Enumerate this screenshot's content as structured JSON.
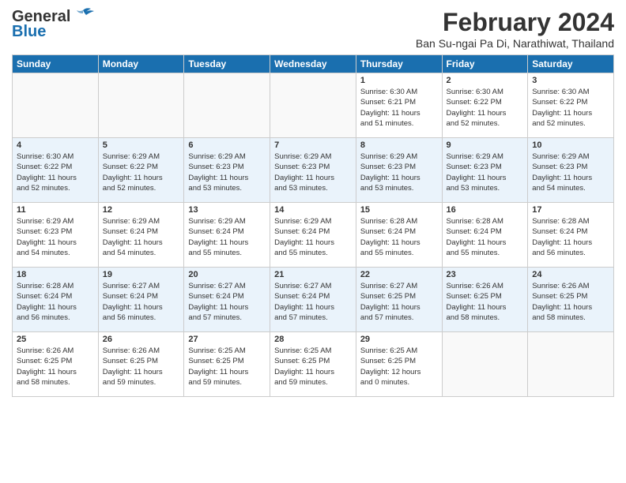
{
  "header": {
    "logo_line1": "General",
    "logo_line2": "Blue",
    "month": "February 2024",
    "location": "Ban Su-ngai Pa Di, Narathiwat, Thailand"
  },
  "columns": [
    "Sunday",
    "Monday",
    "Tuesday",
    "Wednesday",
    "Thursday",
    "Friday",
    "Saturday"
  ],
  "weeks": [
    [
      {
        "day": "",
        "info": ""
      },
      {
        "day": "",
        "info": ""
      },
      {
        "day": "",
        "info": ""
      },
      {
        "day": "",
        "info": ""
      },
      {
        "day": "1",
        "info": "Sunrise: 6:30 AM\nSunset: 6:21 PM\nDaylight: 11 hours\nand 51 minutes."
      },
      {
        "day": "2",
        "info": "Sunrise: 6:30 AM\nSunset: 6:22 PM\nDaylight: 11 hours\nand 52 minutes."
      },
      {
        "day": "3",
        "info": "Sunrise: 6:30 AM\nSunset: 6:22 PM\nDaylight: 11 hours\nand 52 minutes."
      }
    ],
    [
      {
        "day": "4",
        "info": "Sunrise: 6:30 AM\nSunset: 6:22 PM\nDaylight: 11 hours\nand 52 minutes."
      },
      {
        "day": "5",
        "info": "Sunrise: 6:29 AM\nSunset: 6:22 PM\nDaylight: 11 hours\nand 52 minutes."
      },
      {
        "day": "6",
        "info": "Sunrise: 6:29 AM\nSunset: 6:23 PM\nDaylight: 11 hours\nand 53 minutes."
      },
      {
        "day": "7",
        "info": "Sunrise: 6:29 AM\nSunset: 6:23 PM\nDaylight: 11 hours\nand 53 minutes."
      },
      {
        "day": "8",
        "info": "Sunrise: 6:29 AM\nSunset: 6:23 PM\nDaylight: 11 hours\nand 53 minutes."
      },
      {
        "day": "9",
        "info": "Sunrise: 6:29 AM\nSunset: 6:23 PM\nDaylight: 11 hours\nand 53 minutes."
      },
      {
        "day": "10",
        "info": "Sunrise: 6:29 AM\nSunset: 6:23 PM\nDaylight: 11 hours\nand 54 minutes."
      }
    ],
    [
      {
        "day": "11",
        "info": "Sunrise: 6:29 AM\nSunset: 6:23 PM\nDaylight: 11 hours\nand 54 minutes."
      },
      {
        "day": "12",
        "info": "Sunrise: 6:29 AM\nSunset: 6:24 PM\nDaylight: 11 hours\nand 54 minutes."
      },
      {
        "day": "13",
        "info": "Sunrise: 6:29 AM\nSunset: 6:24 PM\nDaylight: 11 hours\nand 55 minutes."
      },
      {
        "day": "14",
        "info": "Sunrise: 6:29 AM\nSunset: 6:24 PM\nDaylight: 11 hours\nand 55 minutes."
      },
      {
        "day": "15",
        "info": "Sunrise: 6:28 AM\nSunset: 6:24 PM\nDaylight: 11 hours\nand 55 minutes."
      },
      {
        "day": "16",
        "info": "Sunrise: 6:28 AM\nSunset: 6:24 PM\nDaylight: 11 hours\nand 55 minutes."
      },
      {
        "day": "17",
        "info": "Sunrise: 6:28 AM\nSunset: 6:24 PM\nDaylight: 11 hours\nand 56 minutes."
      }
    ],
    [
      {
        "day": "18",
        "info": "Sunrise: 6:28 AM\nSunset: 6:24 PM\nDaylight: 11 hours\nand 56 minutes."
      },
      {
        "day": "19",
        "info": "Sunrise: 6:27 AM\nSunset: 6:24 PM\nDaylight: 11 hours\nand 56 minutes."
      },
      {
        "day": "20",
        "info": "Sunrise: 6:27 AM\nSunset: 6:24 PM\nDaylight: 11 hours\nand 57 minutes."
      },
      {
        "day": "21",
        "info": "Sunrise: 6:27 AM\nSunset: 6:24 PM\nDaylight: 11 hours\nand 57 minutes."
      },
      {
        "day": "22",
        "info": "Sunrise: 6:27 AM\nSunset: 6:25 PM\nDaylight: 11 hours\nand 57 minutes."
      },
      {
        "day": "23",
        "info": "Sunrise: 6:26 AM\nSunset: 6:25 PM\nDaylight: 11 hours\nand 58 minutes."
      },
      {
        "day": "24",
        "info": "Sunrise: 6:26 AM\nSunset: 6:25 PM\nDaylight: 11 hours\nand 58 minutes."
      }
    ],
    [
      {
        "day": "25",
        "info": "Sunrise: 6:26 AM\nSunset: 6:25 PM\nDaylight: 11 hours\nand 58 minutes."
      },
      {
        "day": "26",
        "info": "Sunrise: 6:26 AM\nSunset: 6:25 PM\nDaylight: 11 hours\nand 59 minutes."
      },
      {
        "day": "27",
        "info": "Sunrise: 6:25 AM\nSunset: 6:25 PM\nDaylight: 11 hours\nand 59 minutes."
      },
      {
        "day": "28",
        "info": "Sunrise: 6:25 AM\nSunset: 6:25 PM\nDaylight: 11 hours\nand 59 minutes."
      },
      {
        "day": "29",
        "info": "Sunrise: 6:25 AM\nSunset: 6:25 PM\nDaylight: 12 hours\nand 0 minutes."
      },
      {
        "day": "",
        "info": ""
      },
      {
        "day": "",
        "info": ""
      }
    ]
  ]
}
